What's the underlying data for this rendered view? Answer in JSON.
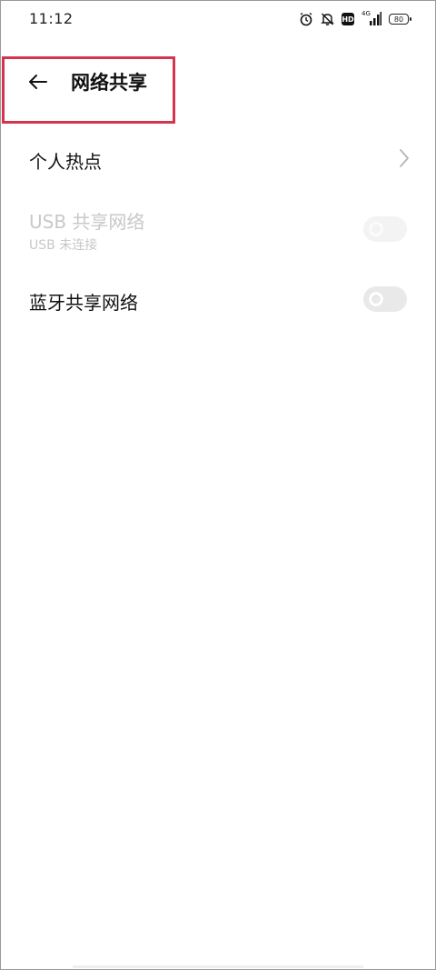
{
  "status_bar": {
    "time": "11:12",
    "hd_label": "HD",
    "network_label": "4G",
    "battery": "80",
    "icons": [
      "alarm-icon",
      "mute-icon",
      "hd-icon",
      "signal-icon",
      "battery-icon"
    ]
  },
  "header": {
    "title": "网络共享",
    "back_icon": "arrow-left-icon"
  },
  "items": [
    {
      "title": "个人热点",
      "control": "chevron"
    },
    {
      "title": "USB 共享网络",
      "subtitle": "USB 未连接",
      "control": "toggle",
      "enabled": false,
      "on": false
    },
    {
      "title": "蓝牙共享网络",
      "control": "toggle",
      "enabled": true,
      "on": false
    }
  ],
  "colors": {
    "highlight": "#d6344e",
    "disabled_text": "#c8c8c8",
    "toggle_bg": "#e9e9e9"
  }
}
